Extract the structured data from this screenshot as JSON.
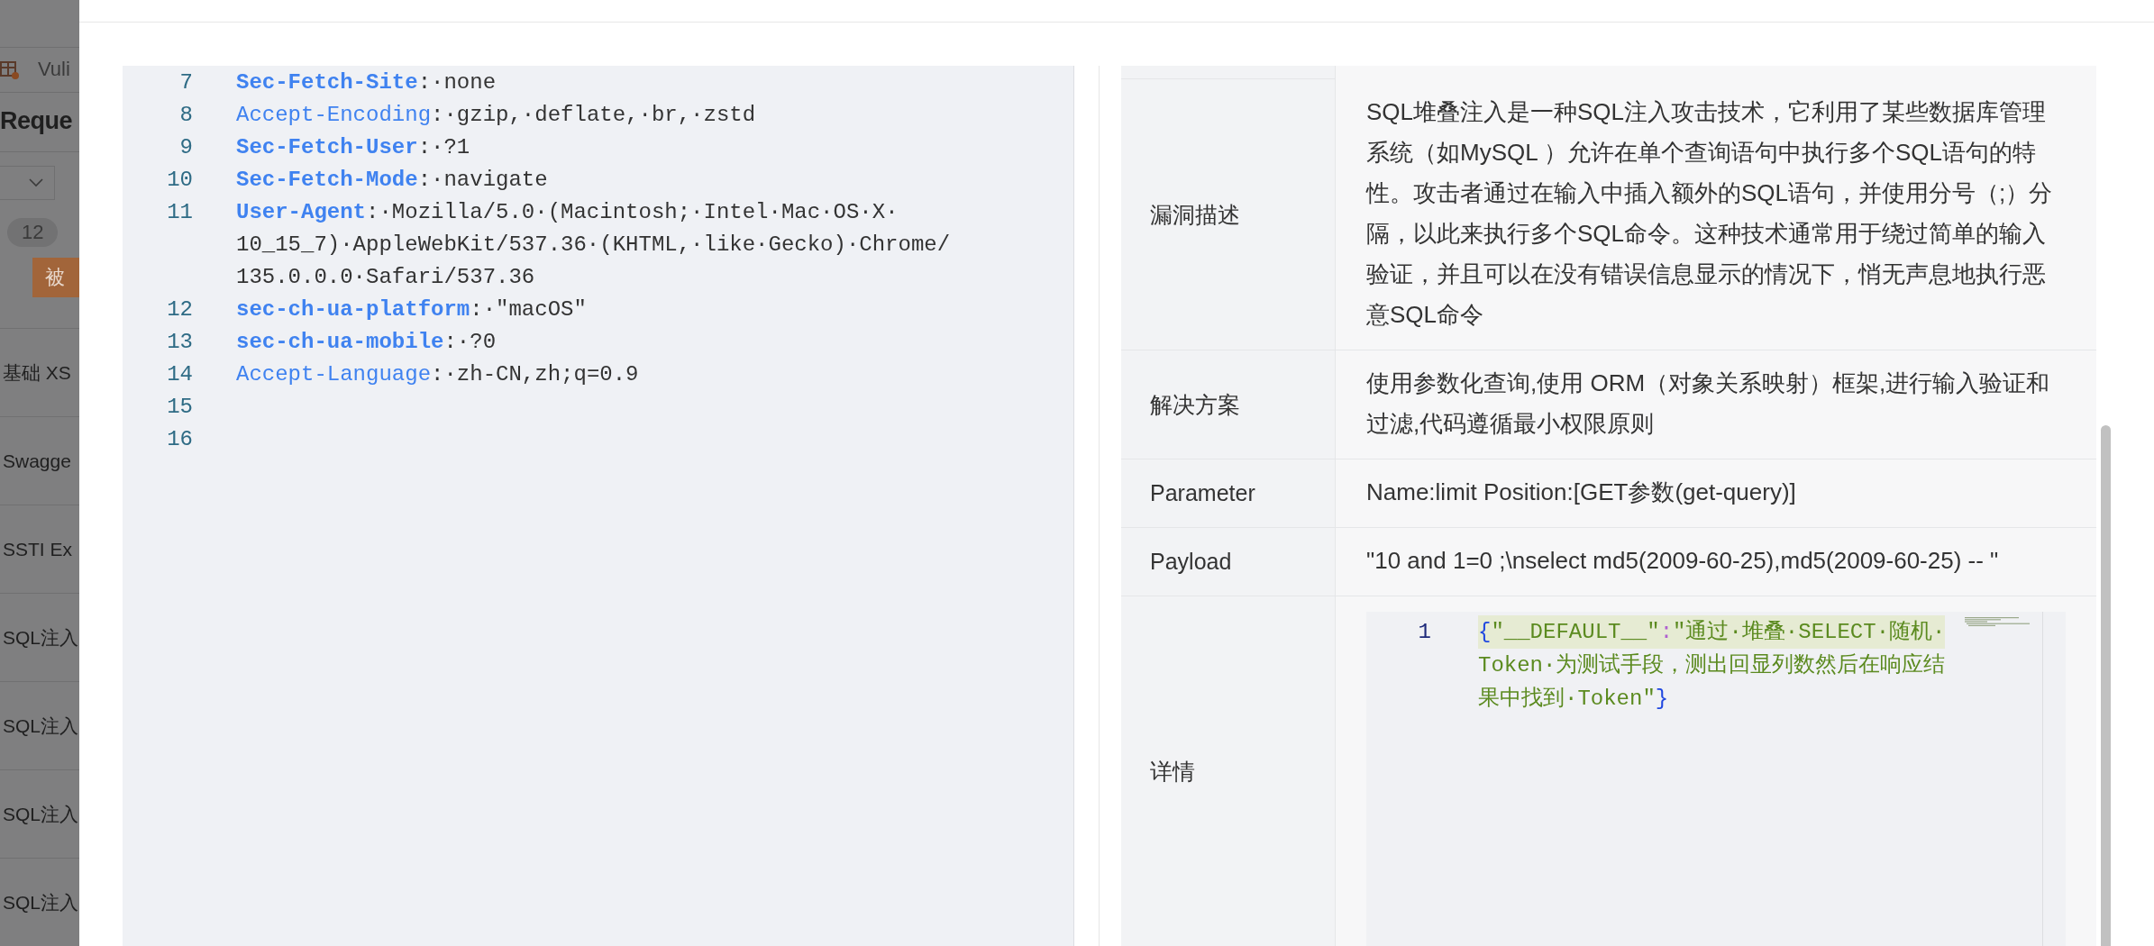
{
  "background_page": {
    "tab_label": "Vuli",
    "heading": "Reque",
    "page_size": "12",
    "action_button": "被",
    "list_items": [
      "基础 XS",
      "Swagge",
      "SSTI Ex",
      "SQL注入",
      "SQL注入",
      "SQL注入",
      "SQL注入"
    ]
  },
  "request_editor": {
    "lines": [
      {
        "number": "7",
        "key": "Sec-Fetch-Site",
        "strong": true,
        "value": ":·none"
      },
      {
        "number": "8",
        "key": "Accept-Encoding",
        "strong": false,
        "value": ":·gzip,·deflate,·br,·zstd"
      },
      {
        "number": "9",
        "key": "Sec-Fetch-User",
        "strong": true,
        "value": ":·?1"
      },
      {
        "number": "10",
        "key": "Sec-Fetch-Mode",
        "strong": true,
        "value": ":·navigate"
      },
      {
        "number": "11",
        "key": "User-Agent",
        "strong": true,
        "value": ":·Mozilla/5.0·(Macintosh;·Intel·Mac·OS·X·",
        "continued": [
          "10_15_7)·AppleWebKit/537.36·(KHTML,·like·Gecko)·Chrome/",
          "135.0.0.0·Safari/537.36"
        ]
      },
      {
        "number": "12",
        "key": "sec-ch-ua-platform",
        "strong": true,
        "value": ":·\"macOS\""
      },
      {
        "number": "13",
        "key": "sec-ch-ua-mobile",
        "strong": true,
        "value": ":·?0"
      },
      {
        "number": "14",
        "key": "Accept-Language",
        "strong": false,
        "value": ":·zh-CN,zh;q=0.9"
      },
      {
        "number": "15"
      },
      {
        "number": "16"
      }
    ]
  },
  "details_table": {
    "rows": [
      {
        "label": "漏洞描述",
        "kind": "text",
        "value": "SQL堆叠注入是一种SQL注入攻击技术，它利用了某些数据库管理系统（如MySQL ）允许在单个查询语句中执行多个SQL语句的特性。攻击者通过在输入中插入额外的SQL语句，并使用分号（;）分隔，以此来执行多个SQL命令。这种技术通常用于绕过简单的输入验证，并且可以在没有错误信息显示的情况下，悄无声息地执行恶意SQL命令"
      },
      {
        "label": "解决方案",
        "kind": "text",
        "value": "使用参数化查询,使用 ORM（对象关系映射）框架,进行输入验证和过滤,代码遵循最小权限原则"
      },
      {
        "label": "Parameter",
        "kind": "text",
        "value": "Name:limit Position:[GET参数(get-query)]"
      },
      {
        "label": "Payload",
        "kind": "text",
        "value": "\"10 and 1=0 ;\\nselect md5(2009-60-25),md5(2009-60-25) -- \""
      },
      {
        "label": "详情",
        "kind": "code",
        "line_number": "1",
        "code_lines": [
          [
            {
              "t": "{",
              "kind": "brace"
            },
            {
              "t": "\"__DEFAULT__\"",
              "kind": "string"
            },
            {
              "t": ":",
              "kind": "colon"
            },
            {
              "t": "\"通过·堆叠·SELECT·随机·",
              "kind": "string"
            }
          ],
          [
            {
              "t": "Token·为测试手段，测出回显列数然后在响应结",
              "kind": "string"
            }
          ],
          [
            {
              "t": "果中找到·Token\"",
              "kind": "string"
            },
            {
              "t": "}",
              "kind": "brace"
            }
          ]
        ]
      }
    ]
  }
}
